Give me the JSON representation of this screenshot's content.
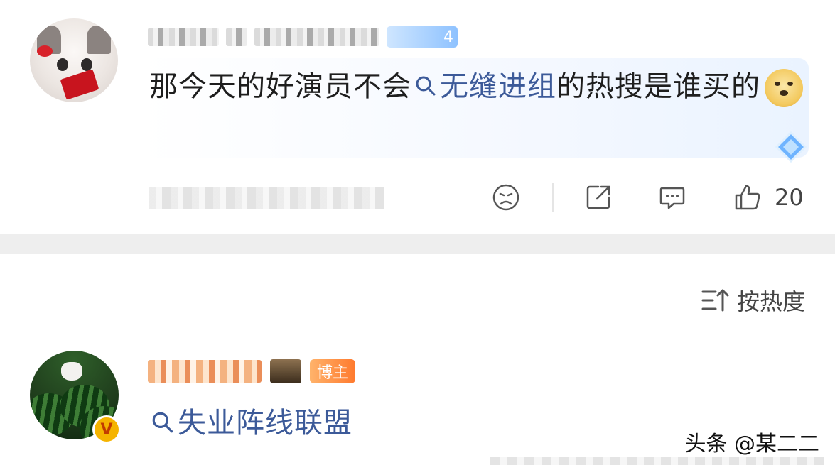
{
  "comment1": {
    "level_badge": "4",
    "text_before": "那今天的好演员不会",
    "topic": "无缝进组",
    "text_after": "的热搜是谁买的",
    "like_count": "20"
  },
  "sort": {
    "label": "按热度"
  },
  "comment2": {
    "author_badge": "博主",
    "topic": "失业阵线联盟",
    "vip_letter": "V"
  },
  "watermark": "头条 @某二二",
  "icons": {
    "search": "search-icon",
    "dislike": "sad-face-icon",
    "share": "share-icon",
    "reply": "comment-icon",
    "like": "thumbs-up-icon",
    "sort": "sort-icon"
  },
  "colors": {
    "topic_link": "#3c5a99",
    "author_badge": "#ff8a3d",
    "section_divider": "#eeeeee"
  }
}
